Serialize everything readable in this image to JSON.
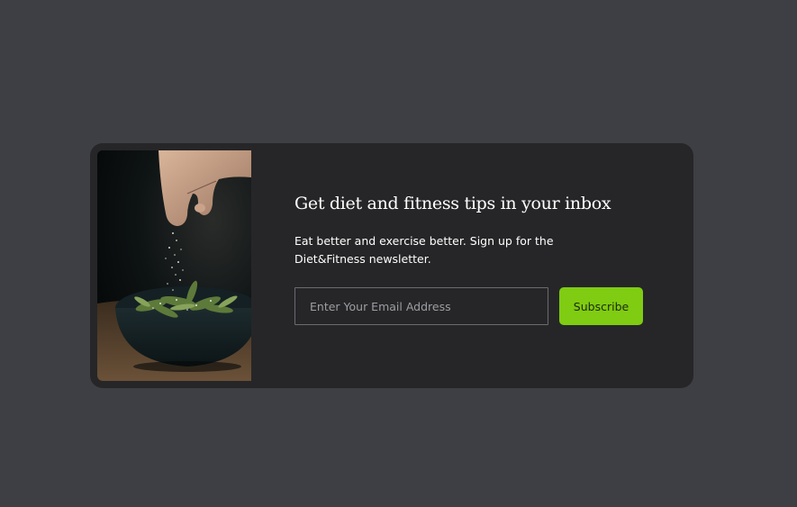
{
  "newsletter": {
    "title": "Get diet and fitness tips in your inbox",
    "description": "Eat better and exercise better. Sign up for the Diet&Fitness newsletter.",
    "email_placeholder": "Enter Your Email Address",
    "email_value": "",
    "subscribe_label": "Subscribe",
    "image_subject": "hand-sprinkling-salt-over-edamame-bowl"
  },
  "colors": {
    "page_background": "#3e3f44",
    "card_background": "#262628",
    "accent": "#7fcc12",
    "input_border": "#6b6b70",
    "text": "#ffffff"
  }
}
